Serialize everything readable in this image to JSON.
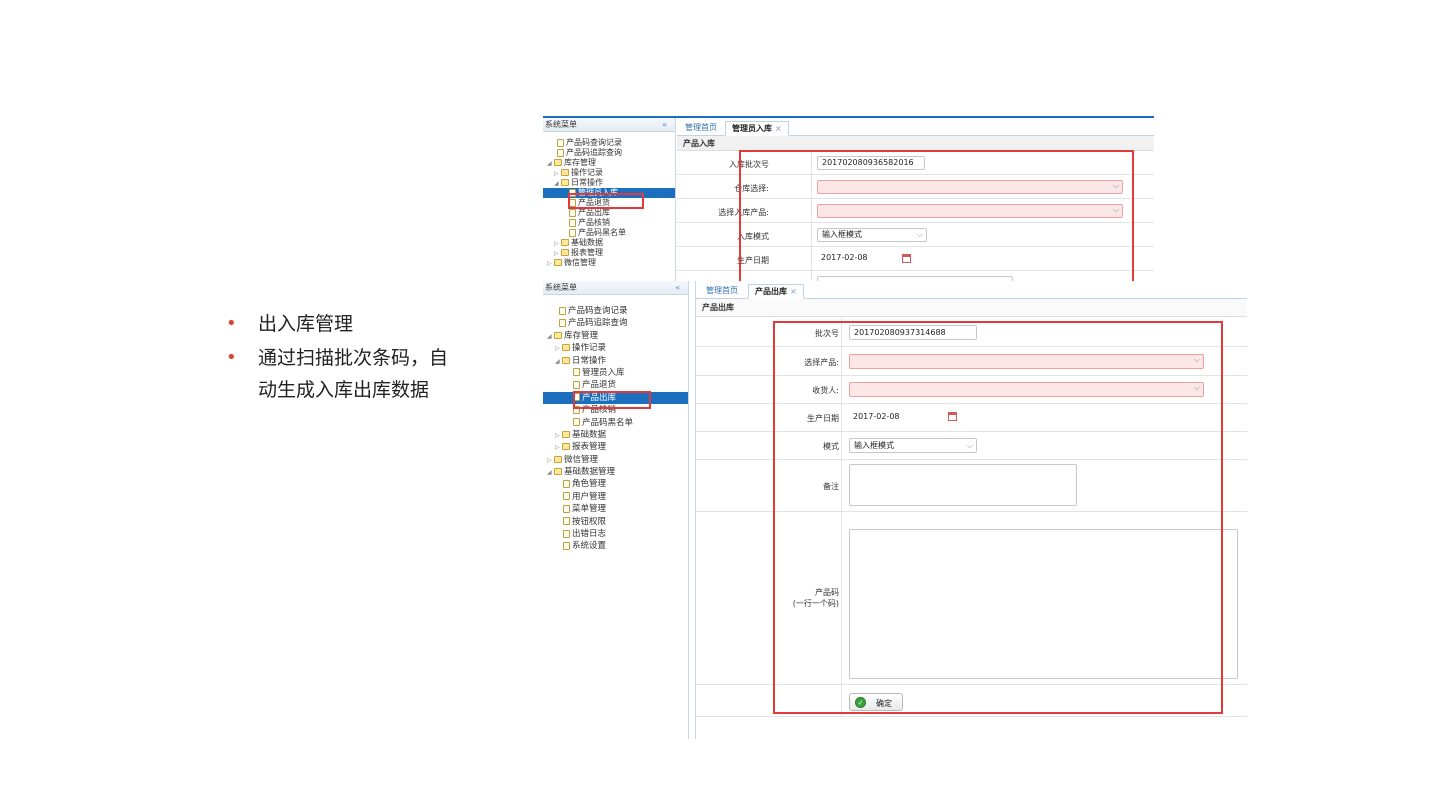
{
  "bullets": [
    {
      "text": "出入库管理"
    },
    {
      "text": "通过扫描批次条码，自动生成入库出库数据",
      "line1": "通过扫描批次条码，自",
      "line2": "动生成入库出库数据"
    }
  ],
  "top_shot": {
    "sidebar": {
      "title": "系统菜单",
      "collapse": "«",
      "items": [
        {
          "label": "产品码查询记录",
          "type": "file"
        },
        {
          "label": "产品码追踪查询",
          "type": "file"
        },
        {
          "label": "库存管理",
          "type": "folder",
          "arrow": "◢"
        },
        {
          "label": "操作记录",
          "type": "folder",
          "arrow": "▷"
        },
        {
          "label": "日常操作",
          "type": "folder",
          "arrow": "◢"
        },
        {
          "label": "管理员入库",
          "type": "file",
          "selected": true
        },
        {
          "label": "产品退货",
          "type": "file"
        },
        {
          "label": "产品出库",
          "type": "file"
        },
        {
          "label": "产品核销",
          "type": "file"
        },
        {
          "label": "产品码黑名单",
          "type": "file"
        },
        {
          "label": "基础数据",
          "type": "folder",
          "arrow": "▷"
        },
        {
          "label": "报表管理",
          "type": "folder",
          "arrow": "▷"
        },
        {
          "label": "微信管理",
          "type": "folder",
          "arrow": "▷"
        }
      ]
    },
    "tabs": [
      {
        "label": "管理首页"
      },
      {
        "label": "管理员入库",
        "close": "×",
        "active": true
      }
    ],
    "panel_title": "产品入库",
    "form": {
      "batch_label": "入库批次号",
      "batch_value": "201702080936582016",
      "warehouse_label": "仓库选择:",
      "product_label": "选择入库产品:",
      "mode_label": "入库模式",
      "mode_value": "输入框模式",
      "date_label": "生产日期",
      "date_value": "2017-02-08"
    }
  },
  "bottom_shot": {
    "sidebar": {
      "title": "系统菜单",
      "collapse": "«",
      "items": [
        {
          "label": "产品码查询记录",
          "type": "file"
        },
        {
          "label": "产品码追踪查询",
          "type": "file"
        },
        {
          "label": "库存管理",
          "type": "folder",
          "arrow": "◢"
        },
        {
          "label": "操作记录",
          "type": "folder",
          "arrow": "▷"
        },
        {
          "label": "日常操作",
          "type": "folder",
          "arrow": "◢"
        },
        {
          "label": "管理员入库",
          "type": "file"
        },
        {
          "label": "产品退货",
          "type": "file"
        },
        {
          "label": "产品出库",
          "type": "file",
          "selected": true
        },
        {
          "label": "产品核销",
          "type": "file"
        },
        {
          "label": "产品码黑名单",
          "type": "file"
        },
        {
          "label": "基础数据",
          "type": "folder",
          "arrow": "▷"
        },
        {
          "label": "报表管理",
          "type": "folder",
          "arrow": "▷"
        },
        {
          "label": "微信管理",
          "type": "folder",
          "arrow": "▷"
        },
        {
          "label": "基础数据管理",
          "type": "folder",
          "arrow": "◢"
        },
        {
          "label": "角色管理",
          "type": "file"
        },
        {
          "label": "用户管理",
          "type": "file"
        },
        {
          "label": "菜单管理",
          "type": "file"
        },
        {
          "label": "按钮权限",
          "type": "file"
        },
        {
          "label": "出错日志",
          "type": "file"
        },
        {
          "label": "系统设置",
          "type": "file"
        }
      ]
    },
    "tabs": [
      {
        "label": "管理首页"
      },
      {
        "label": "产品出库",
        "close": "×",
        "active": true
      }
    ],
    "panel_title": "产品出库",
    "form": {
      "batch_label": "批次号",
      "batch_value": "201702080937314688",
      "product_label": "选择产品:",
      "receiver_label": "收货人:",
      "date_label": "生产日期",
      "date_value": "2017-02-08",
      "mode_label": "模式",
      "mode_value": "输入框模式",
      "remark_label": "备注",
      "code_label": "产品码",
      "code_hint": "(一行一个码)",
      "confirm_label": "确定"
    }
  },
  "colors": {
    "accent": "#1b6fbf",
    "highlight": "#e23a3a",
    "bullet": "#d9432f"
  }
}
